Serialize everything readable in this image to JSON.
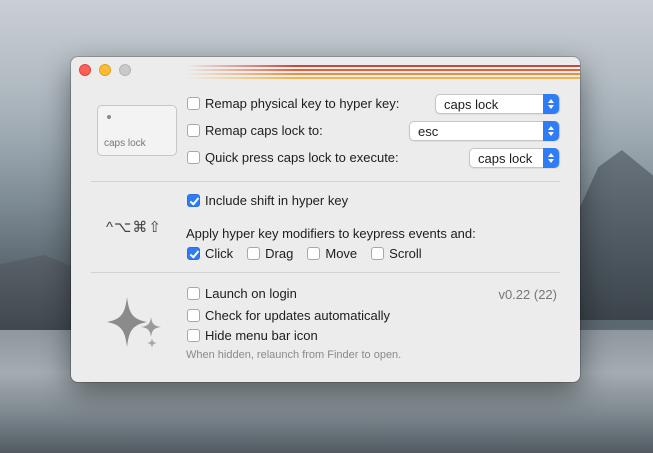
{
  "settings": {
    "remap_physical": {
      "label": "Remap physical key to hyper key:",
      "checked": false,
      "value": "caps lock"
    },
    "remap_caps": {
      "label": "Remap caps lock to:",
      "checked": false,
      "value": "esc"
    },
    "quick_press": {
      "label": "Quick press caps lock to execute:",
      "checked": false,
      "value": "caps lock"
    },
    "keycap_label": "caps lock"
  },
  "modifiers": {
    "symbols": "^⌥⌘⇧",
    "include_shift": {
      "label": "Include shift in hyper key",
      "checked": true
    },
    "apply_label": "Apply hyper key modifiers to keypress events and:",
    "events": [
      {
        "label": "Click",
        "checked": true
      },
      {
        "label": "Drag",
        "checked": false
      },
      {
        "label": "Move",
        "checked": false
      },
      {
        "label": "Scroll",
        "checked": false
      }
    ]
  },
  "general": {
    "launch_login": {
      "label": "Launch on login",
      "checked": false
    },
    "check_updates": {
      "label": "Check for updates automatically",
      "checked": false
    },
    "hide_icon": {
      "label": "Hide menu bar icon",
      "checked": false
    },
    "hint": "When hidden, relaunch from Finder to open.",
    "version": "v0.22 (22)"
  },
  "colors": {
    "accent": "#2f7cf6",
    "stripes": [
      "#c9463d",
      "#d9643a",
      "#e98f3c",
      "#f1b447"
    ]
  }
}
